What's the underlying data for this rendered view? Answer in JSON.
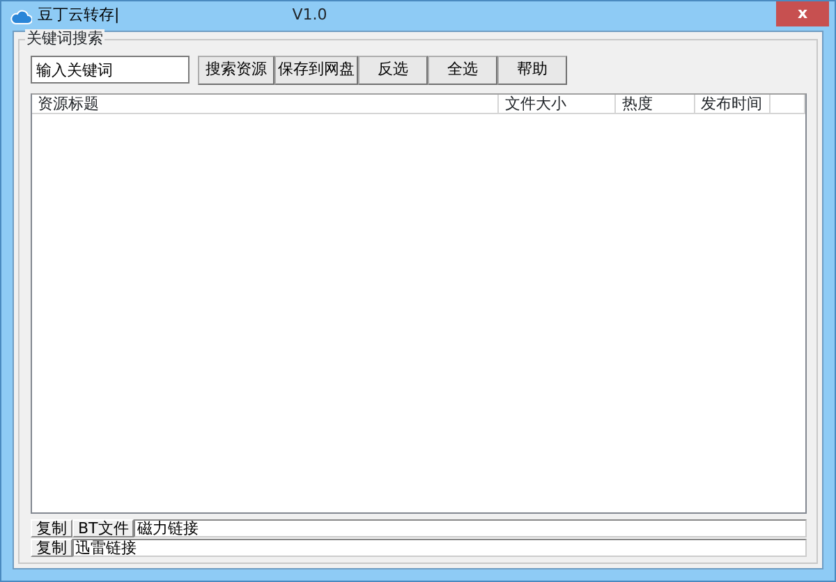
{
  "window": {
    "title": "豆丁云转存|",
    "version": "V1.0",
    "close": "x"
  },
  "group": {
    "title": "关键词搜索"
  },
  "search": {
    "value": "输入关键词"
  },
  "buttons": [
    "搜索资源",
    "保存到网盘",
    "反选",
    "全选",
    "帮助"
  ],
  "table": {
    "columns": [
      "资源标题",
      "文件大小",
      "热度",
      "发布时间"
    ]
  },
  "links": [
    {
      "buttons": [
        "复制",
        "BT文件"
      ],
      "value": "磁力链接"
    },
    {
      "buttons": [
        "复制"
      ],
      "value": "迅雷链接"
    }
  ]
}
